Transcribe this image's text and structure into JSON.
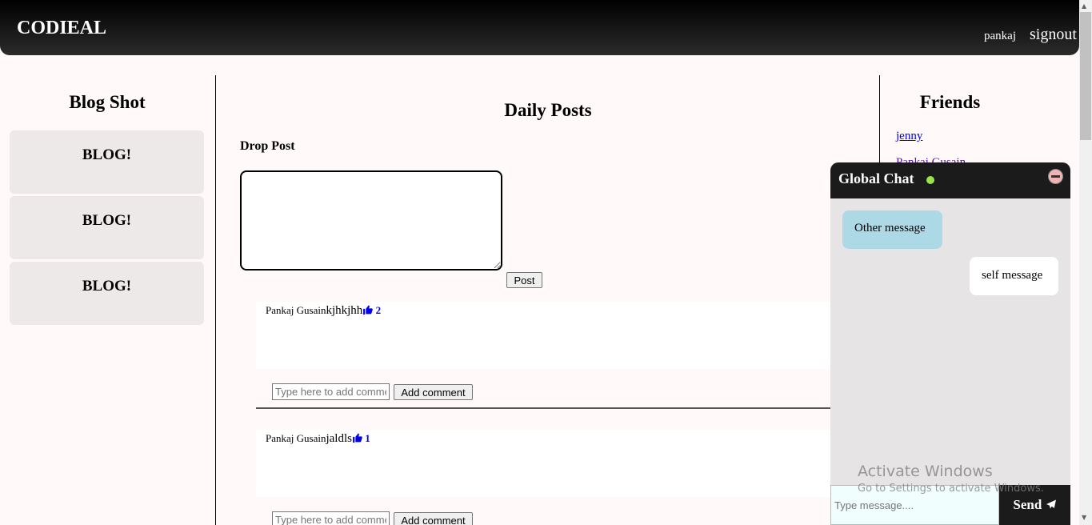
{
  "navbar": {
    "brand": "CODIEAL",
    "user": "pankaj",
    "signout": "signout"
  },
  "left": {
    "title": "Blog Shot",
    "cards": [
      "BLOG!",
      "BLOG!",
      "BLOG!"
    ]
  },
  "main": {
    "title": "Daily Posts",
    "drop_label": "Drop Post",
    "post_button": "Post",
    "posts": [
      {
        "author": "Pankaj Gusain",
        "content": "kjhkjhh",
        "likes": "2",
        "comment_placeholder": "Type here to add comment",
        "comment_button": "Add comment"
      },
      {
        "author": "Pankaj Gusain",
        "content": "jaldls",
        "likes": "1",
        "comment_placeholder": "Type here to add comment",
        "comment_button": "Add comment"
      }
    ]
  },
  "friends": {
    "title": "Friends",
    "items": [
      "jenny",
      "Pankaj Gusain"
    ]
  },
  "chat": {
    "title": "Global Chat",
    "status_color": "#9be34b",
    "messages": [
      {
        "type": "other",
        "text": "Other message"
      },
      {
        "type": "self",
        "text": "self message"
      }
    ],
    "input_placeholder": "Type message....",
    "send_label": "Send"
  },
  "watermark": {
    "line1": "Activate Windows",
    "line2": "Go to Settings to activate Windows."
  }
}
